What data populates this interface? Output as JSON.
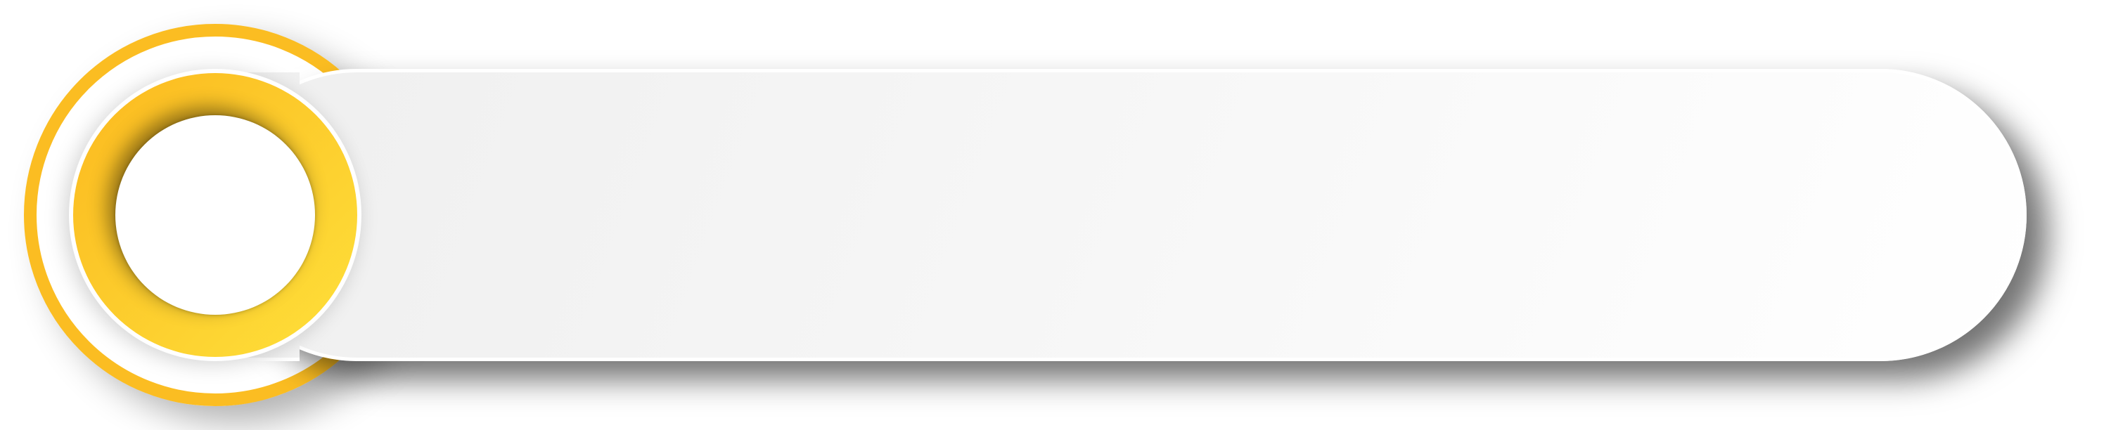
{
  "graphic": {
    "accent_color": "#fbbd22",
    "badge_gradient": [
      "#fbb91f",
      "#fee03a"
    ],
    "banner_color": "#f4f4f4",
    "center_color": "#ffffff"
  }
}
